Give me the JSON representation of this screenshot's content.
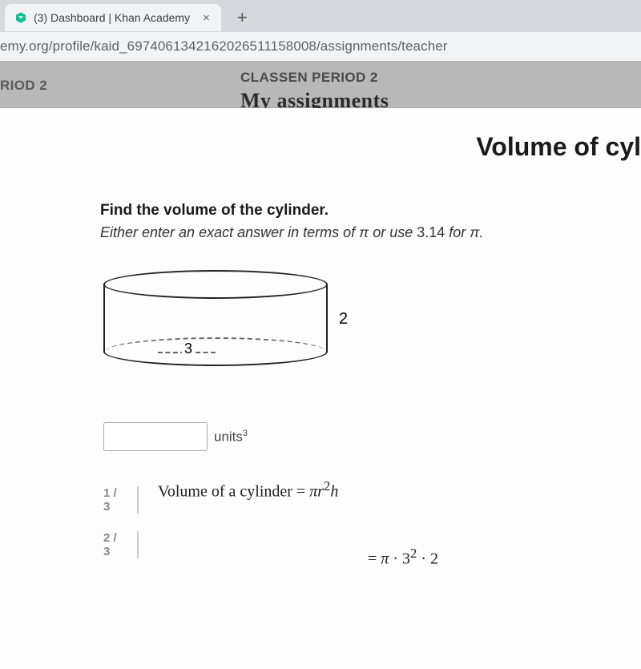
{
  "browser": {
    "tab_title": "(3) Dashboard | Khan Academy",
    "url_visible": "emy.org/profile/kaid_6974061342162026511158008/assignments/teacher"
  },
  "header": {
    "left_crumb": "RIOD 2",
    "center_crumb": "CLASSEN PERIOD 2",
    "sub_heading_partial": "My assignments"
  },
  "page": {
    "title_partial": "Volume of cyl"
  },
  "question": {
    "prompt_bold": "Find the volume of the cylinder.",
    "prompt_instruction_prefix": "Either enter an exact answer in terms of ",
    "prompt_instruction_mid": " or use ",
    "pi_approx": "3.14",
    "prompt_instruction_suffix": " for π.",
    "diagram": {
      "radius": "3",
      "height": "2"
    },
    "answer_units": "units",
    "answer_units_exp": "3"
  },
  "hints": {
    "step1_num": "1 / 3",
    "step1_text": "Volume of a cylinder = πr²h",
    "step2_num": "2 / 3",
    "step2_text": "= π · 3² · 2"
  }
}
